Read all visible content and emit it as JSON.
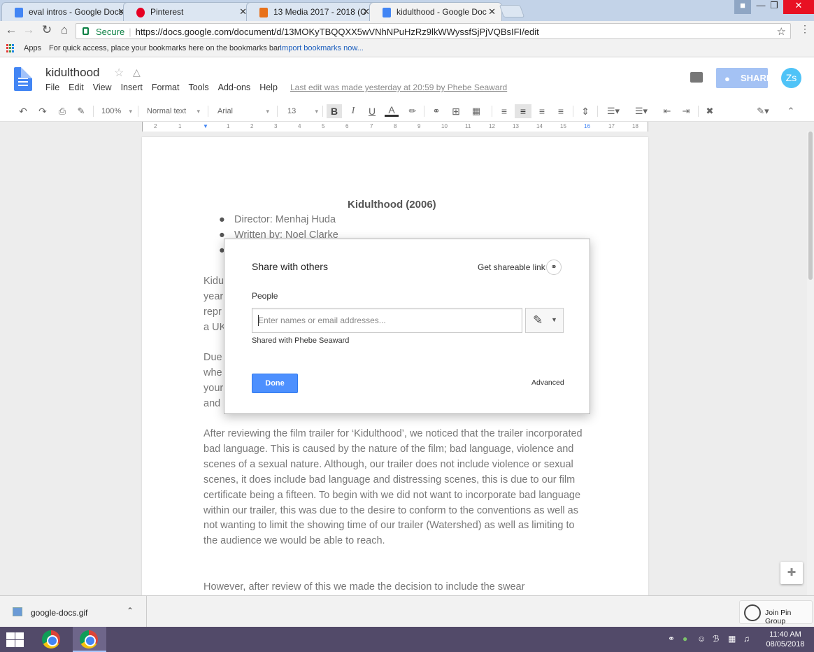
{
  "browser": {
    "tabs": [
      {
        "title": "eval intros - Google Docs",
        "icon_color": "#4285f4",
        "active": false
      },
      {
        "title": "Pinterest",
        "icon_color": "#e60023",
        "active": false
      },
      {
        "title": "13 Media 2017 - 2018 (C",
        "icon_color": "#e8711a",
        "active": false
      },
      {
        "title": "kidulthood - Google Doc",
        "icon_color": "#4285f4",
        "active": true
      }
    ],
    "close_glyph": "✕",
    "address": {
      "secure_label": "Secure",
      "url": "https://docs.google.com/document/d/13MOKyTBQQXX5wVNhNPuHzRz9lkWWyssfSjPjVQBsIFI/edit"
    },
    "bookmarks": {
      "apps_label": "Apps",
      "hint": "For quick access, place your bookmarks here on the bookmarks bar.",
      "import_link": "Import bookmarks now..."
    }
  },
  "doc": {
    "title": "kidulthood",
    "menu": [
      "File",
      "Edit",
      "View",
      "Insert",
      "Format",
      "Tools",
      "Add-ons",
      "Help"
    ],
    "last_edit": "Last edit was made yesterday at 20:59 by Phebe Seaward",
    "share_label": "SHARE",
    "avatar_initials": "Zs"
  },
  "toolbar": {
    "zoom": "100%",
    "style": "Normal text",
    "font": "Arial",
    "size": "13"
  },
  "ruler_marks": [
    "2",
    "1",
    "1",
    "2",
    "3",
    "4",
    "5",
    "6",
    "7",
    "8",
    "9",
    "10",
    "11",
    "12",
    "13",
    "14",
    "15",
    "16",
    "17",
    "18"
  ],
  "content": {
    "heading": "Kidulthood (2006)",
    "bullets": [
      "Director: Menhaj Huda",
      "Written by: Noel Clarke"
    ],
    "partial_lines": [
      "Kidu",
      "year",
      "repr",
      "a UK",
      "Due",
      "whe",
      "your",
      "and"
    ],
    "paragraph": "After reviewing the film trailer for ‘Kidulthood’, we noticed that the trailer incorporated bad language. This is caused by the nature of the film; bad language, violence and scenes of a sexual nature. Although, our trailer does not include violence or sexual scenes, it does include bad language and distressing scenes, this is due to our film certificate being a fifteen. To begin with we did not want to incorporate bad language within our trailer, this was due to the desire to conform to the conventions as well as not wanting to limit the showing time of our trailer (Watershed) as well as limiting to the audience we would be able to reach.",
    "last_line": "However, after review of this we made the decision to include the swear"
  },
  "share_dialog": {
    "title": "Share with others",
    "link_label": "Get shareable link",
    "people_label": "People",
    "input_placeholder": "Enter names or email addresses...",
    "shared_with": "Shared with Phebe Seaward",
    "done_label": "Done",
    "advanced_label": "Advanced"
  },
  "downloads": {
    "file": "google-docs.gif",
    "pin_label": "Join Pin Group"
  },
  "taskbar": {
    "time": "11:40 AM",
    "date": "08/05/2018"
  }
}
